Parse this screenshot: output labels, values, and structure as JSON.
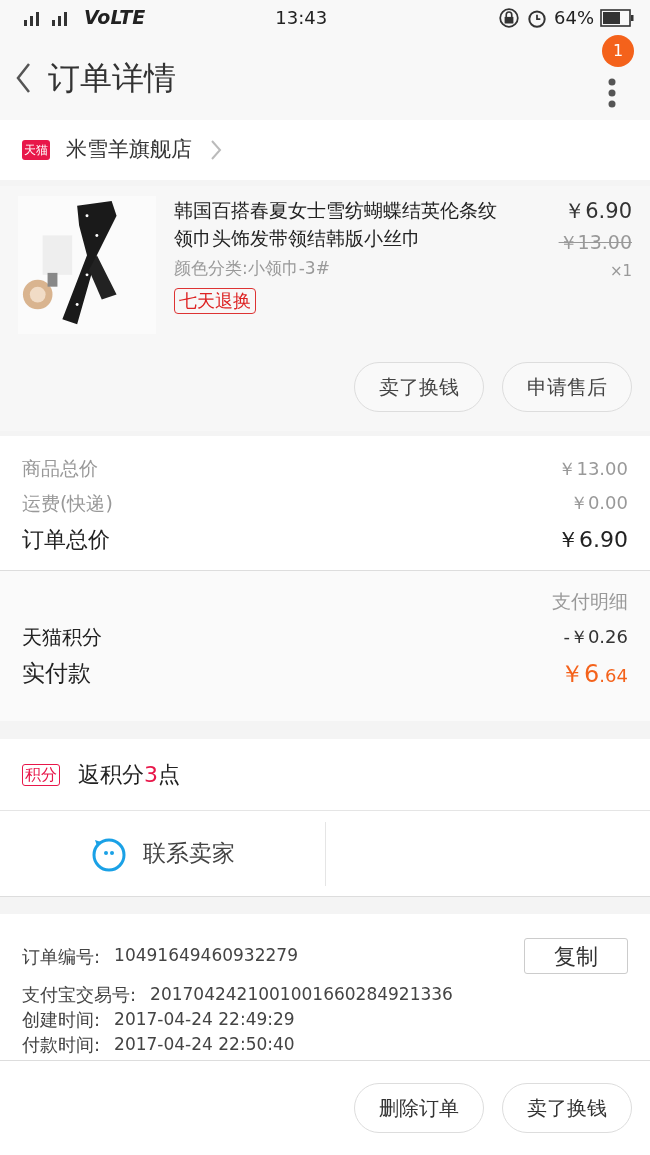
{
  "status_bar": {
    "network": "VoLTE",
    "time": "13:43",
    "battery": "64%"
  },
  "header": {
    "title": "订单详情",
    "badge": "1"
  },
  "shop": {
    "tag": "天猫",
    "name": "米雪羊旗舰店"
  },
  "product": {
    "title": "韩国百搭春夏女士雪纺蝴蝶结英伦条纹领巾头饰发带领结韩版小丝巾",
    "variant": "颜色分类:小领巾-3#",
    "tag": "七天退换",
    "price": "￥6.90",
    "original_price": "￥13.00",
    "quantity": "×1",
    "buttons": [
      "卖了换钱",
      "申请售后"
    ]
  },
  "summary": [
    {
      "label": "商品总价",
      "value": "￥13.00",
      "kind": "minor"
    },
    {
      "label": "运费(快递)",
      "value": "￥0.00",
      "kind": "minor"
    },
    {
      "label": "订单总价",
      "value": "￥6.90",
      "kind": "major"
    }
  ],
  "payment": {
    "title": "支付明细",
    "rows": [
      {
        "label": "天猫积分",
        "value": "-￥0.26"
      }
    ],
    "paid": {
      "label": "实付款",
      "major": "￥6",
      "minor": ".64"
    }
  },
  "points": {
    "tag": "积分",
    "prefix": "返积分",
    "count": "3",
    "suffix": "点"
  },
  "contact": {
    "label": "联系卖家"
  },
  "order_info": {
    "copy": "复制",
    "rows": [
      {
        "label": "订单编号:",
        "value": "10491649460932279"
      },
      {
        "label": "支付宝交易号:",
        "value": "2017042421001001660284921336"
      },
      {
        "label": "创建时间:",
        "value": "2017-04-24 22:49:29"
      },
      {
        "label": "付款时间:",
        "value": "2017-04-24 22:50:40"
      }
    ]
  },
  "footer_buttons": [
    "删除订单",
    "卖了换钱"
  ]
}
